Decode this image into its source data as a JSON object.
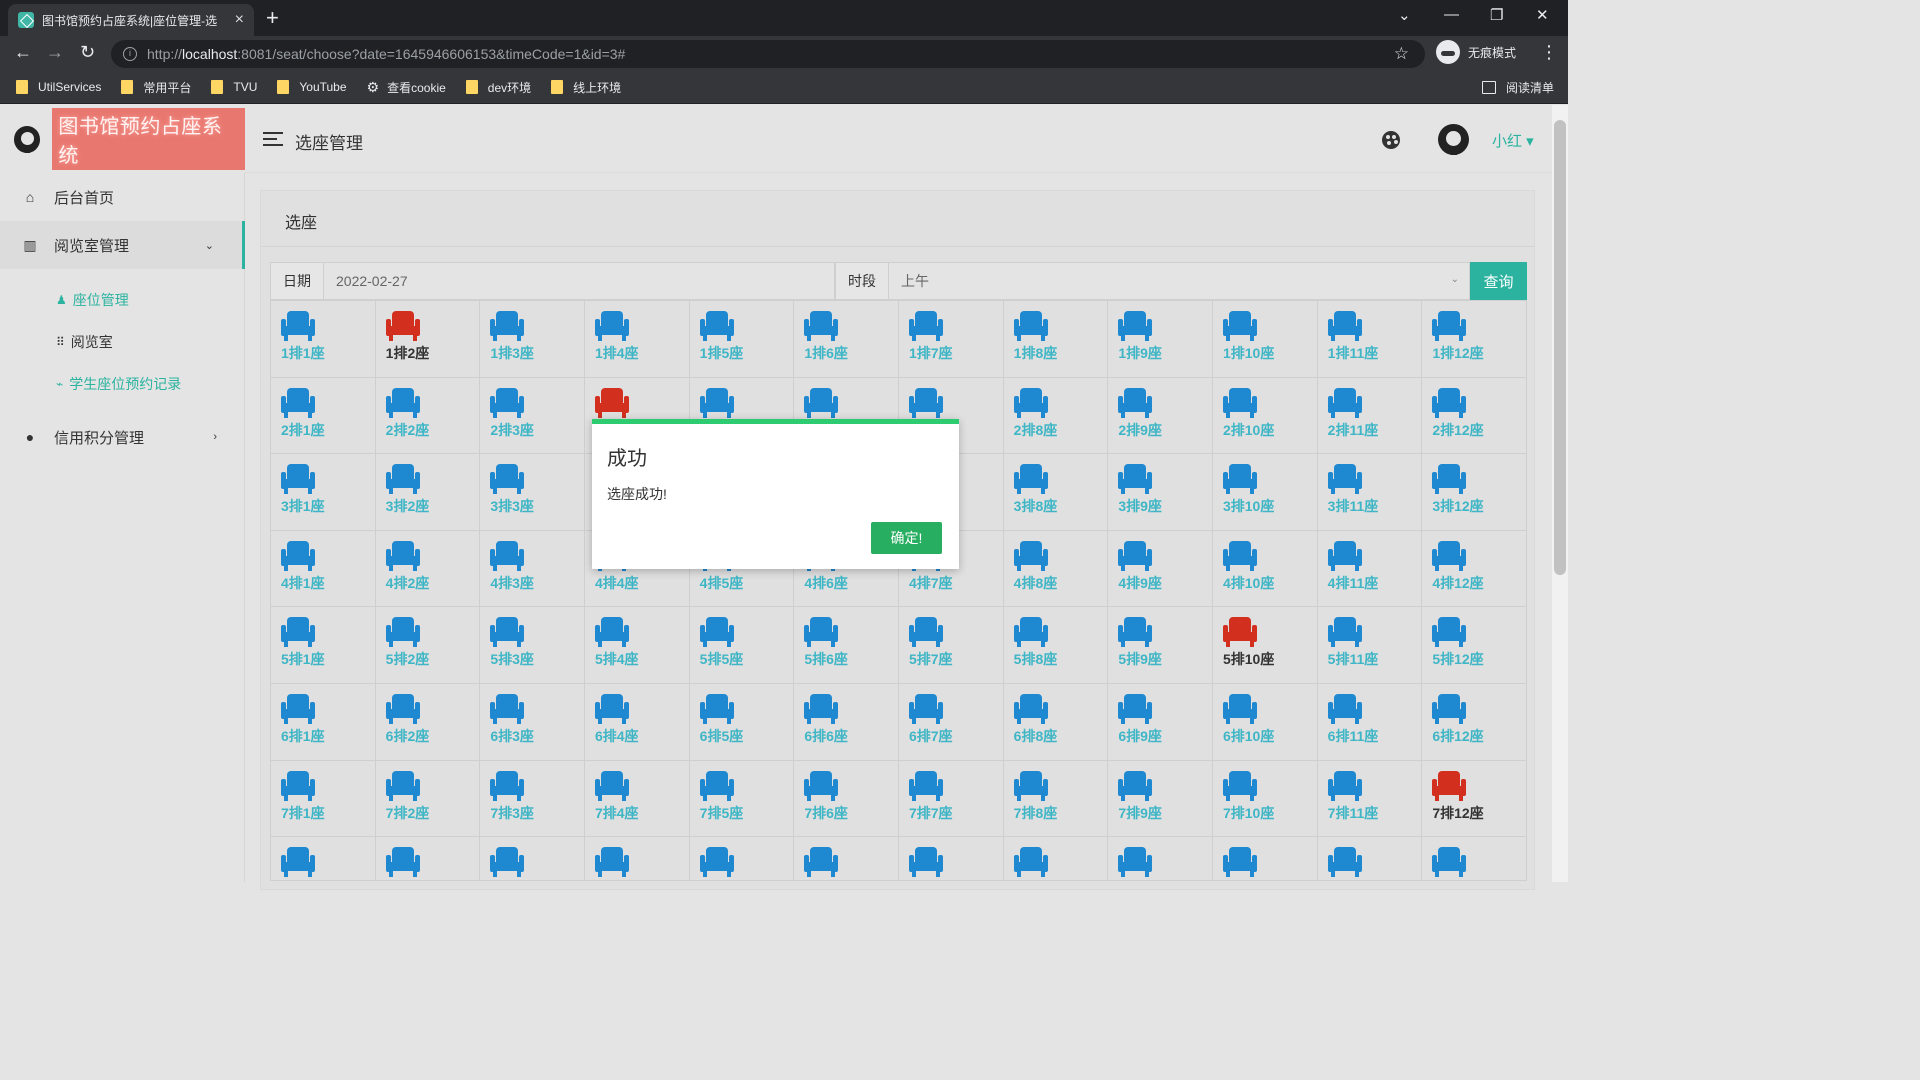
{
  "browser": {
    "tab_title": "图书馆预约占座系统|座位管理-选",
    "tab_close": "×",
    "new_tab": "+",
    "url_scheme": "http://",
    "url_host": "localhost",
    "url_rest": ":8081/seat/choose?date=1645946606153&timeCode=1&id=3#",
    "incognito_label": "无痕模式",
    "reading_list": "阅读清单",
    "bookmarks": [
      {
        "label": "UtilServices",
        "icon": "folder-icon"
      },
      {
        "label": "常用平台",
        "icon": "folder-icon"
      },
      {
        "label": "TVU",
        "icon": "folder-icon"
      },
      {
        "label": "YouTube",
        "icon": "folder-icon"
      },
      {
        "label": "查看cookie",
        "icon": "gear-icon"
      },
      {
        "label": "dev环境",
        "icon": "folder-icon"
      },
      {
        "label": "线上环境",
        "icon": "folder-icon"
      }
    ]
  },
  "app": {
    "logo_text": "图书馆预约占座系统",
    "page_title": "选座管理",
    "user_name": "小红",
    "accent": "#2bb3a0"
  },
  "sidebar": {
    "home": "后台首页",
    "reading_room_mgmt": "阅览室管理",
    "seat_mgmt": "座位管理",
    "reading_room": "阅览室",
    "booking_records": "学生座位预约记录",
    "credit_mgmt": "信用积分管理"
  },
  "card": {
    "title": "选座"
  },
  "query": {
    "date_label": "日期",
    "date_value": "2022-02-27",
    "period_label": "时段",
    "period_value": "上午",
    "submit": "查询"
  },
  "seats": {
    "rows_full": 7,
    "cols": 12,
    "label_row_suffix": "排",
    "label_seat_suffix": "座",
    "taken": [
      "1-2",
      "2-4",
      "5-10",
      "7-12"
    ],
    "partial_row_count": 12
  },
  "dialog": {
    "title": "成功",
    "message": "选座成功!",
    "ok": "确定!",
    "accent": "#2ecc71"
  }
}
